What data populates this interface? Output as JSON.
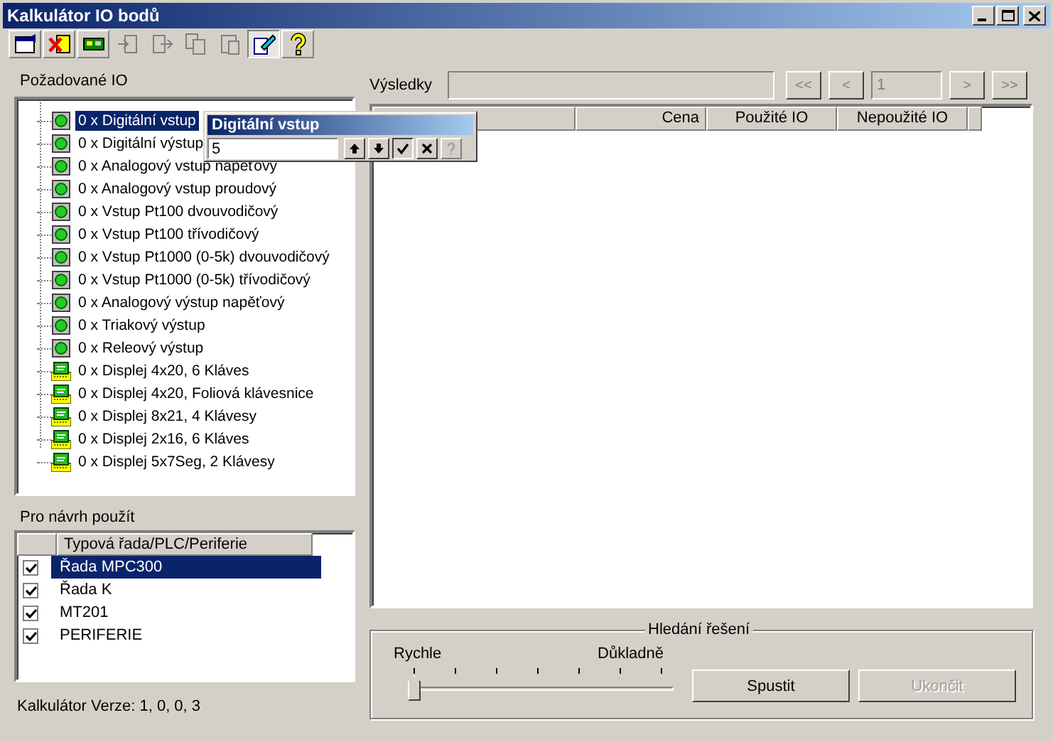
{
  "window": {
    "title": "Kalkulátor IO bodů"
  },
  "toolbar": [
    {
      "kind": "properties",
      "disabled": false,
      "selected": false
    },
    {
      "kind": "delete",
      "disabled": false,
      "selected": false
    },
    {
      "kind": "module",
      "disabled": false,
      "selected": false
    },
    {
      "kind": "import",
      "disabled": true,
      "selected": false
    },
    {
      "kind": "export",
      "disabled": true,
      "selected": false
    },
    {
      "kind": "copy",
      "disabled": true,
      "selected": false
    },
    {
      "kind": "paste",
      "disabled": true,
      "selected": false
    },
    {
      "kind": "edit",
      "disabled": false,
      "selected": true
    },
    {
      "kind": "help",
      "disabled": false,
      "selected": false
    }
  ],
  "required_io": {
    "label": "Požadované IO",
    "items": [
      {
        "kind": "io",
        "label": "0 x Digitální vstup",
        "selected": true
      },
      {
        "kind": "io",
        "label": "0 x Digitální výstup",
        "selected": false
      },
      {
        "kind": "io",
        "label": "0 x Analogový vstup napěťový",
        "selected": false
      },
      {
        "kind": "io",
        "label": "0 x Analogový vstup proudový",
        "selected": false
      },
      {
        "kind": "io",
        "label": "0 x Vstup Pt100 dvouvodičový",
        "selected": false
      },
      {
        "kind": "io",
        "label": "0 x Vstup Pt100 třívodičový",
        "selected": false
      },
      {
        "kind": "io",
        "label": "0 x Vstup Pt1000 (0-5k) dvouvodičový",
        "selected": false
      },
      {
        "kind": "io",
        "label": "0 x Vstup Pt1000 (0-5k) třívodičový",
        "selected": false
      },
      {
        "kind": "io",
        "label": "0 x Analogový výstup napěťový",
        "selected": false
      },
      {
        "kind": "io",
        "label": "0 x Triakový výstup",
        "selected": false
      },
      {
        "kind": "io",
        "label": "0 x Releový výstup",
        "selected": false
      },
      {
        "kind": "display",
        "label": "0 x Displej 4x20, 6 Kláves",
        "selected": false
      },
      {
        "kind": "display",
        "label": "0 x Displej 4x20, Foliová klávesnice",
        "selected": false
      },
      {
        "kind": "display",
        "label": "0 x Displej 8x21,  4 Klávesy",
        "selected": false
      },
      {
        "kind": "display",
        "label": "0 x Displej 2x16,  6 Kláves",
        "selected": false
      },
      {
        "kind": "display",
        "label": "0 x Displej 5x7Seg, 2 Klávesy",
        "selected": false
      }
    ]
  },
  "editor": {
    "title": "Digitální vstup",
    "value": "5",
    "buttons": [
      {
        "kind": "up",
        "disabled": false
      },
      {
        "kind": "down",
        "disabled": false
      },
      {
        "kind": "ok",
        "disabled": false
      },
      {
        "kind": "cancel",
        "disabled": false
      },
      {
        "kind": "help",
        "disabled": true
      }
    ]
  },
  "usage": {
    "label": "Pro návrh použít",
    "column": "Typová řada/PLC/Periferie",
    "rows": [
      {
        "label": "Řada MPC300",
        "checked": true,
        "selected": true
      },
      {
        "label": "Řada K",
        "checked": true,
        "selected": false
      },
      {
        "label": "MT201",
        "checked": true,
        "selected": false
      },
      {
        "label": "PERIFERIE",
        "checked": true,
        "selected": false
      }
    ]
  },
  "version": {
    "label": "Kalkulátor Verze:",
    "value": "1, 0, 0, 3"
  },
  "results": {
    "label": "Výsledky",
    "page": "1",
    "nav": [
      {
        "label": "<<",
        "disabled": true
      },
      {
        "label": "<",
        "disabled": true
      },
      {
        "label": ">",
        "disabled": true
      },
      {
        "label": ">>",
        "disabled": true
      }
    ],
    "columns": [
      {
        "label": "Cena"
      },
      {
        "label": "Použité IO"
      },
      {
        "label": "Nepoužité IO"
      }
    ]
  },
  "search": {
    "title": "Hledání řešení",
    "min_label": "Rychle",
    "max_label": "Důkladně",
    "level": 0,
    "buttons": [
      {
        "label": "Spustit",
        "disabled": false
      },
      {
        "label": "Ukončit",
        "disabled": true
      }
    ]
  }
}
